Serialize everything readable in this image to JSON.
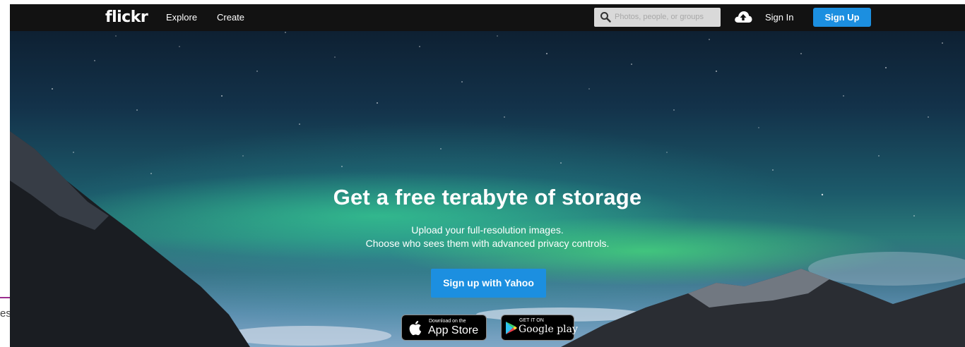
{
  "left_edge": {
    "fragment_text": "es"
  },
  "navbar": {
    "logo": "flickr",
    "links": [
      {
        "label": "Explore"
      },
      {
        "label": "Create"
      }
    ],
    "search": {
      "placeholder": "Photos, people, or groups",
      "value": "",
      "icon": "search-icon"
    },
    "upload_icon": "cloud-upload-icon",
    "sign_in": "Sign In",
    "sign_up": "Sign Up"
  },
  "hero": {
    "headline": "Get a free terabyte of storage",
    "subtext_line1": "Upload your full-resolution images.",
    "subtext_line2": "Choose who sees them with advanced privacy controls.",
    "cta": "Sign up with Yahoo",
    "app_store": {
      "small": "Download on the",
      "big": "App Store",
      "icon": "apple-icon"
    },
    "google_play": {
      "small": "GET IT ON",
      "big": "Google play",
      "icon": "google-play-icon"
    }
  },
  "colors": {
    "navbar_bg": "#121212",
    "accent_blue": "#1c8fe0",
    "left_edge_accent": "#9b2d8e"
  }
}
